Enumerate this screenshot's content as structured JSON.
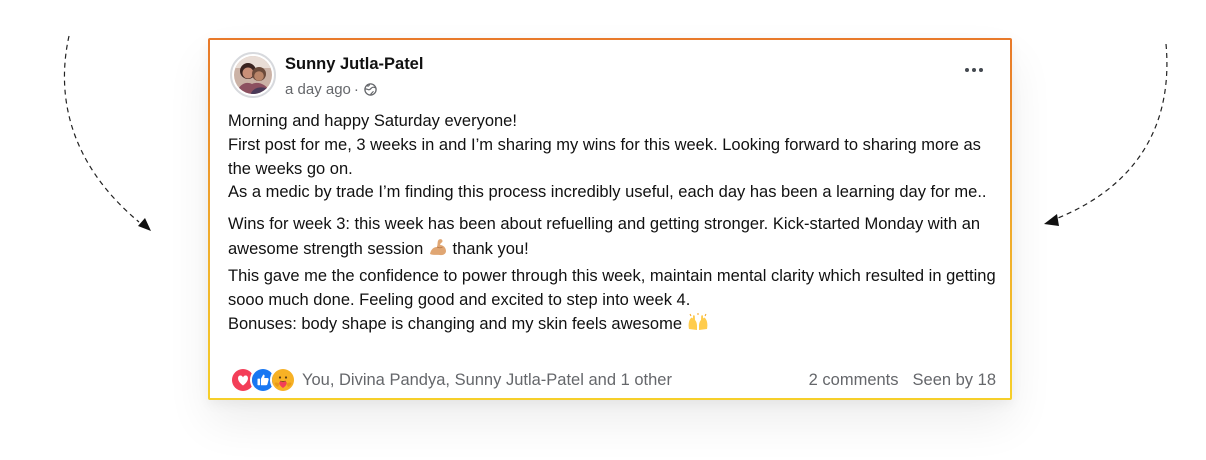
{
  "post": {
    "author": "Sunny Jutla-Patel",
    "timestamp": "a day ago",
    "separator": "·",
    "privacy_icon": "globe-icon",
    "more_icon": "more-options-icon",
    "body": {
      "line1": "Morning and happy Saturday everyone!",
      "line2": "First post for me, 3 weeks in and I’m sharing my wins for this week. Looking forward to sharing more as the weeks go on.",
      "line3": "As a medic by trade I’m finding this process incredibly useful, each day has been a learning day for me..",
      "line4a": "Wins for week 3: this week has been about refuelling and getting stronger. Kick-started Monday with an awesome strength session ",
      "line4_emoji": "flexed-biceps-emoji",
      "line4b": " thank you!",
      "line5": "This gave me the confidence to power through this week, maintain mental clarity which resulted in getting sooo much done. Feeling good and excited to step into week 4.",
      "line6": "Bonuses: body shape is changing and my skin feels awesome ",
      "line6_emoji": "raising-hands-emoji"
    },
    "footer": {
      "reactions": [
        "love-reaction-icon",
        "like-reaction-icon",
        "care-reaction-icon"
      ],
      "reactors": "You, Divina Pandya, Sunny Jutla-Patel and 1 other",
      "comments": "2 comments",
      "seen": "Seen by 18"
    }
  },
  "colors": {
    "border_top": "#e8792a",
    "border_bottom": "#f6cf2a",
    "love": "#f33e58",
    "like": "#1877f2",
    "care": "#f7b125",
    "secondary_text": "#65676b"
  }
}
